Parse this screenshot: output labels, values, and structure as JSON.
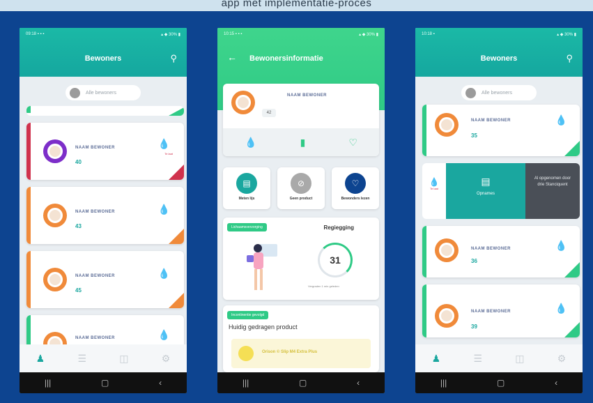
{
  "header_text": "app met implementatie-proces",
  "phones": {
    "left": {
      "status_time": "09:18 ▪ ▪ ▪",
      "status_right": "▴ ◆ 30% ▮",
      "title": "Bewoners",
      "filter_label": "Alle bewoners",
      "residents": [
        {
          "name": "NAAM BEWONER",
          "room": "40",
          "status": "Te laat"
        },
        {
          "name": "NAAM BEWONER",
          "room": "43"
        },
        {
          "name": "NAAM BEWONER",
          "room": "45"
        },
        {
          "name": "NAAM BEWONER"
        }
      ]
    },
    "middle": {
      "status_time": "10:15 ▪ ▪ ▪",
      "status_right": "▴ ◆ 30% ▮",
      "title": "Bewonersinformatie",
      "resident_name": "NAAM BEWONER",
      "room": "42",
      "actions": [
        "Meten lijs",
        "Geen product",
        "Bewonders lezen"
      ],
      "section1_tag": "Lichaamsverzorging",
      "section1_title": "Regiegging",
      "ring_value": "31",
      "ring_sub": "Vergraden 1 min geleden",
      "section2_tag": "Incontinentie gevolgd",
      "section2_title": "Huidig gedragen product",
      "product_label": "Orison © Slip M4 Extra Plus"
    },
    "right": {
      "status_time": "10:18 ▪",
      "status_right": "▴ ◆ 30% ▮",
      "title": "Bewoners",
      "filter_label": "Alle bewoners",
      "residents": [
        {
          "name": "NAAM BEWONER",
          "room": "35"
        },
        {
          "name": "NAAM BEWONER",
          "room": "36"
        },
        {
          "name": "NAAM BEWONER",
          "room": "39"
        }
      ],
      "swipe_left": "Te laat",
      "swipe_mid": "Opnames",
      "swipe_right": "Al opgenomen door drie Stanciquent"
    }
  },
  "colors": {
    "teal": "#1aa79f",
    "green": "#2fca86",
    "red": "#d0324d",
    "orange": "#f08a3a",
    "background": "#0d4490"
  }
}
